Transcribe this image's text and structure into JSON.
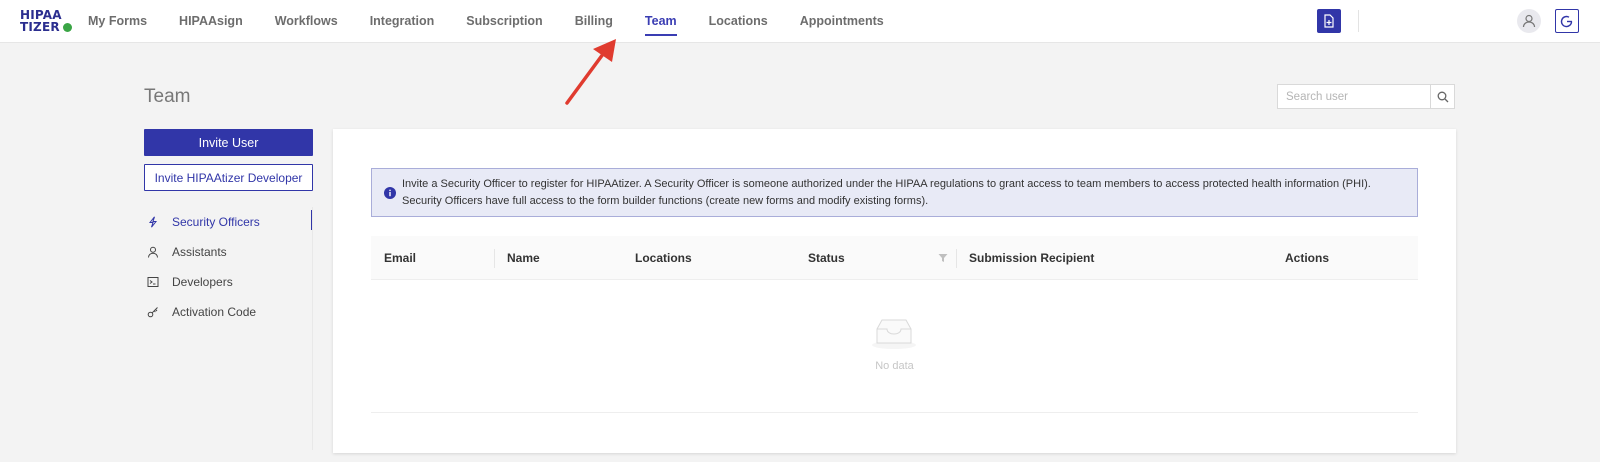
{
  "brand": {
    "logo_line1": "HIPAA",
    "logo_line2": "TIZER",
    "accent": "#3136a8",
    "logo_dot": "#3aa545"
  },
  "nav": {
    "items": [
      {
        "label": "My Forms",
        "active": false
      },
      {
        "label": "HIPAAsign",
        "active": false
      },
      {
        "label": "Workflows",
        "active": false
      },
      {
        "label": "Integration",
        "active": false
      },
      {
        "label": "Subscription",
        "active": false
      },
      {
        "label": "Billing",
        "active": false
      },
      {
        "label": "Team",
        "active": true
      },
      {
        "label": "Locations",
        "active": false
      },
      {
        "label": "Appointments",
        "active": false
      }
    ],
    "icons": [
      "new-form-icon",
      "user-icon",
      "logout-icon"
    ]
  },
  "page": {
    "title": "Team"
  },
  "search": {
    "placeholder": "Search user",
    "value": ""
  },
  "sidebar": {
    "invite_user_label": "Invite User",
    "invite_developer_label": "Invite HIPAAtizer Developer",
    "items": [
      {
        "label": "Security Officers",
        "icon": "lightning-icon",
        "active": true
      },
      {
        "label": "Assistants",
        "icon": "user-icon",
        "active": false
      },
      {
        "label": "Developers",
        "icon": "terminal-icon",
        "active": false
      },
      {
        "label": "Activation Code",
        "icon": "key-icon",
        "active": false
      }
    ]
  },
  "info_banner": {
    "text": "Invite a Security Officer to register for HIPAAtizer. A Security Officer is someone authorized under the HIPAA regulations to grant access to team members to access protected health information (PHI). Security Officers have full access to the form builder functions (create new forms and modify existing forms)."
  },
  "table": {
    "columns": [
      "Email",
      "Name",
      "Locations",
      "Status",
      "Submission Recipient",
      "Actions"
    ],
    "rows": [],
    "empty_text": "No data"
  }
}
